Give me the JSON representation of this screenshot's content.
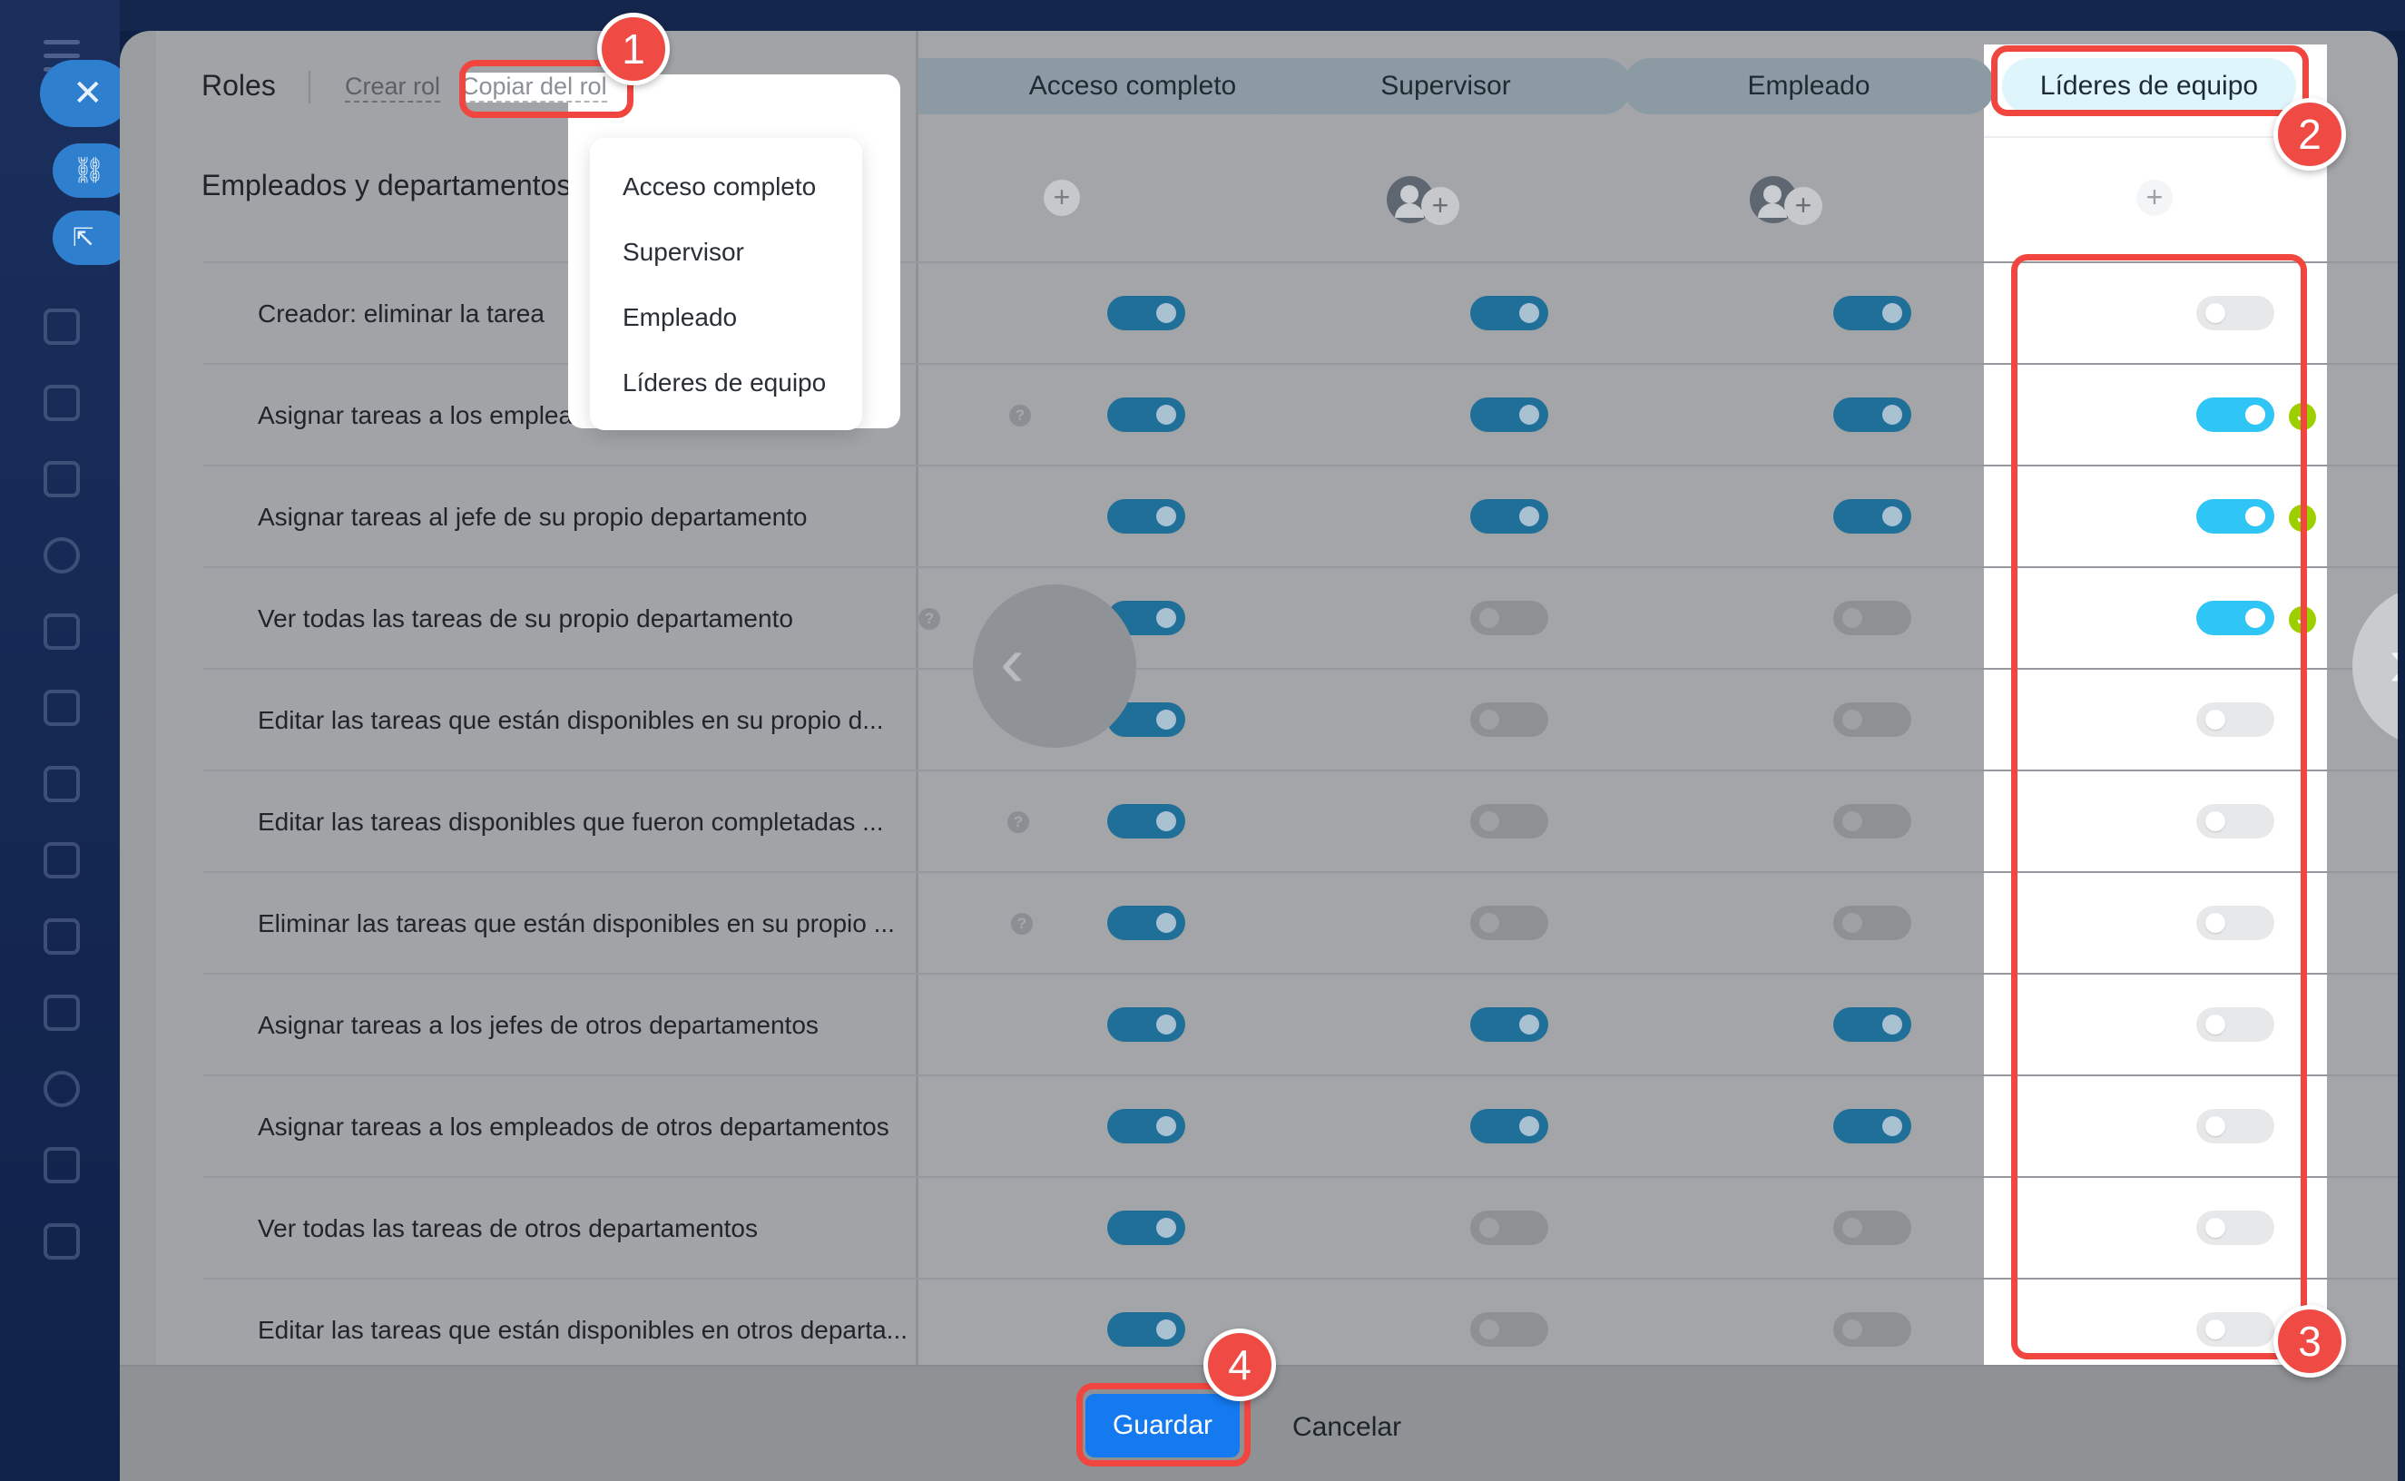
{
  "header": {
    "roles_label": "Roles",
    "create_role": "Crear rol",
    "copy_role": "Copiar del rol",
    "section_label": "Empleados y departamentos",
    "columns": [
      "Acceso completo",
      "Supervisor",
      "Empleado",
      "Líderes de equipo"
    ]
  },
  "dropdown": {
    "items": [
      "Acceso completo",
      "Supervisor",
      "Empleado",
      "Líderes de equipo"
    ]
  },
  "rows": [
    {
      "label": "Creador: eliminar la tarea",
      "help": false,
      "values": [
        true,
        true,
        true,
        false
      ]
    },
    {
      "label": "Asignar tareas a los empleados de su propio departa...",
      "help": true,
      "values": [
        true,
        true,
        true,
        true
      ]
    },
    {
      "label": "Asignar tareas al jefe de su propio departamento",
      "help": false,
      "values": [
        true,
        true,
        true,
        true
      ]
    },
    {
      "label": "Ver todas las tareas de su propio departamento",
      "help": true,
      "values": [
        true,
        false,
        false,
        true
      ]
    },
    {
      "label": "Editar las tareas que están disponibles en su propio d...",
      "help": true,
      "values": [
        true,
        false,
        false,
        false
      ]
    },
    {
      "label": "Editar las tareas disponibles que fueron completadas ...",
      "help": true,
      "values": [
        true,
        false,
        false,
        false
      ]
    },
    {
      "label": "Eliminar las tareas que están disponibles en su propio ...",
      "help": true,
      "values": [
        true,
        false,
        false,
        false
      ]
    },
    {
      "label": "Asignar tareas a los jefes de otros departamentos",
      "help": false,
      "values": [
        true,
        true,
        true,
        false
      ]
    },
    {
      "label": "Asignar tareas a los empleados de otros departamentos",
      "help": false,
      "values": [
        true,
        true,
        true,
        false
      ]
    },
    {
      "label": "Ver todas las tareas de otros departamentos",
      "help": false,
      "values": [
        true,
        false,
        false,
        false
      ]
    },
    {
      "label": "Editar las tareas que están disponibles en otros departa...",
      "help": false,
      "values": [
        true,
        false,
        false,
        false
      ]
    }
  ],
  "footer": {
    "save": "Guardar",
    "cancel": "Cancelar"
  },
  "annotations": [
    "1",
    "2",
    "3",
    "4"
  ],
  "colors": {
    "toggle_on": "#2fc6f6",
    "check": "#9dcf00",
    "save": "#1579f0",
    "annotation": "#ef4a43"
  }
}
